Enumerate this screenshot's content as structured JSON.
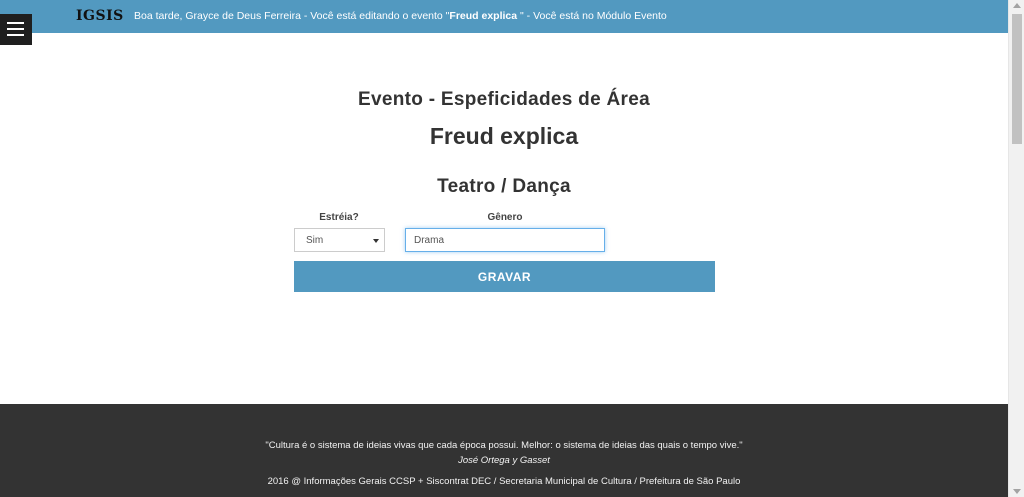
{
  "header": {
    "logo": "IGSIS",
    "greeting": "Boa tarde, Grayce de Deus Ferreira - Você está editando o evento \"",
    "event_bold": "Freud explica",
    "greeting_end": " \" - Você está no Módulo Evento"
  },
  "main": {
    "section_title": "Evento - Espeficidades de Área",
    "event_name": "Freud explica",
    "area_title": "Teatro / Dança",
    "form": {
      "estreia_label": "Estréia?",
      "estreia_value": "Sim",
      "genero_label": "Gênero",
      "genero_value": "Drama",
      "submit_label": "GRAVAR"
    }
  },
  "footer": {
    "quote": "\"Cultura é o sistema de ideias vivas que cada época possui. Melhor: o sistema de ideias das quais o tempo vive.\"",
    "author": "José Ortega y Gasset",
    "copyright": "2016 @ Informações Gerais CCSP + Siscontrat DEC / Secretaria Municipal de Cultura / Prefeitura de São Paulo"
  },
  "colors": {
    "accent": "#5299c0",
    "footer_bg": "#333333",
    "menu_bg": "#1f1f1f"
  }
}
